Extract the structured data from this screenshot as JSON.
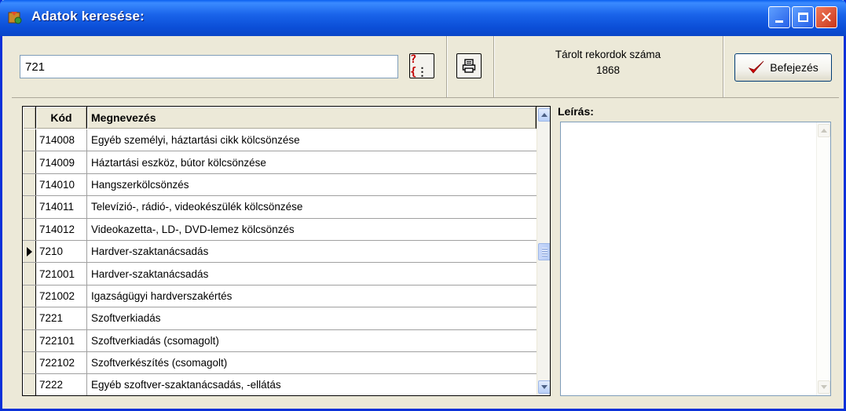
{
  "window": {
    "title": "Adatok keresése:"
  },
  "toolbar": {
    "search_value": "721",
    "help_button_glyph": "?{",
    "help_button_glyph2": "⋮",
    "print_icon": "printer-icon",
    "record_count_label": "Tárolt rekordok száma",
    "record_count": "1868",
    "finish_label": "Befejezés"
  },
  "grid": {
    "columns": {
      "code": "Kód",
      "name": "Megnevezés"
    },
    "rows": [
      {
        "code": "714008",
        "name": "Egyéb személyi, háztartási cikk kölcsönzése",
        "current": false
      },
      {
        "code": "714009",
        "name": "Háztartási eszköz, bútor kölcsönzése",
        "current": false
      },
      {
        "code": "714010",
        "name": "Hangszerkölcsönzés",
        "current": false
      },
      {
        "code": "714011",
        "name": "Televízió-, rádió-, videokészülék kölcsönzése",
        "current": false
      },
      {
        "code": "714012",
        "name": "Videokazetta-, LD-, DVD-lemez kölcsönzés",
        "current": false
      },
      {
        "code": "7210",
        "name": "Hardver-szaktanácsadás",
        "current": true
      },
      {
        "code": "721001",
        "name": "Hardver-szaktanácsadás",
        "current": false
      },
      {
        "code": "721002",
        "name": "Igazságügyi hardverszakértés",
        "current": false
      },
      {
        "code": "7221",
        "name": "Szoftverkiadás",
        "current": false
      },
      {
        "code": "722101",
        "name": "Szoftverkiadás (csomagolt)",
        "current": false
      },
      {
        "code": "722102",
        "name": "Szoftverkészítés (csomagolt)",
        "current": false
      },
      {
        "code": "7222",
        "name": "Egyéb szoftver-szaktanácsadás, -ellátás",
        "current": false
      }
    ]
  },
  "description": {
    "label": "Leírás:",
    "text": ""
  },
  "colors": {
    "titlebar": "#0A5FEF",
    "window_bg": "#ECE9D8",
    "check_mark": "#D40000"
  }
}
